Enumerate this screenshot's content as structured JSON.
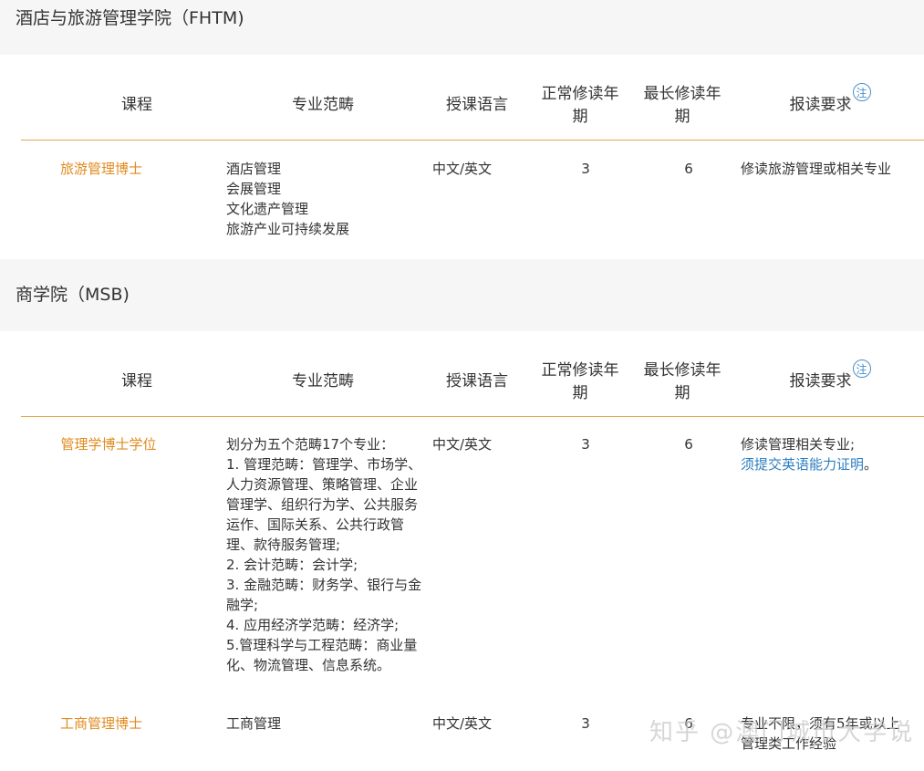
{
  "sections": [
    {
      "title": "酒店与旅游管理学院（FHTM)",
      "headers": {
        "course": "课程",
        "category": "专业范畴",
        "language": "授课语言",
        "normal_years_1": "正常修读年",
        "normal_years_2": "期",
        "max_years_1": "最长修读年",
        "max_years_2": "期",
        "requirement": "报读要求",
        "note_icon": "注"
      },
      "rows": [
        {
          "course": "旅游管理博士",
          "category_lines": [
            "酒店管理",
            "会展管理",
            "文化遗产管理",
            "旅游产业可持续发展"
          ],
          "language": "中文/英文",
          "normal_years": "3",
          "max_years": "6",
          "requirement": "修读旅游管理或相关专业"
        }
      ]
    },
    {
      "title": "商学院（MSB)",
      "headers": {
        "course": "课程",
        "category": "专业范畴",
        "language": "授课语言",
        "normal_years_1": "正常修读年",
        "normal_years_2": "期",
        "max_years_1": "最长修读年",
        "max_years_2": "期",
        "requirement": "报读要求",
        "note_icon": "注"
      },
      "rows": [
        {
          "course": "管理学博士学位",
          "category_lines": [
            "划分为五个范畴17个专业：",
            "1. 管理范畴：管理学、市场学、",
            "人力资源管理、策略管理、企业",
            "管理学、组织行为学、公共服务",
            "运作、国际关系、公共行政管",
            "理、款待服务管理;",
            "2. 会计范畴：会计学;",
            "3. 金融范畴：财务学、银行与金",
            "融学;",
            "4. 应用经济学范畴：经济学;",
            "5.管理科学与工程范畴：商业量",
            "化、物流管理、信息系统。"
          ],
          "language": "中文/英文",
          "normal_years": "3",
          "max_years": "6",
          "requirement_line1": "修读管理相关专业;",
          "requirement_link": "须提交英语能力证明",
          "requirement_end": "。"
        },
        {
          "course": "工商管理博士",
          "category_lines": [
            "工商管理"
          ],
          "language": "中文/英文",
          "normal_years": "3",
          "max_years": "6",
          "requirement_lines": [
            "专业不限，须有5年或以上",
            "管理类工作经验"
          ]
        }
      ]
    }
  ],
  "watermark": "知乎 @澳门城市大学说",
  "colors": {
    "accent": "#e08a1e",
    "rule": "#e3a84e",
    "link": "#2b7ec1",
    "section_bg": "#f6f6f6"
  }
}
